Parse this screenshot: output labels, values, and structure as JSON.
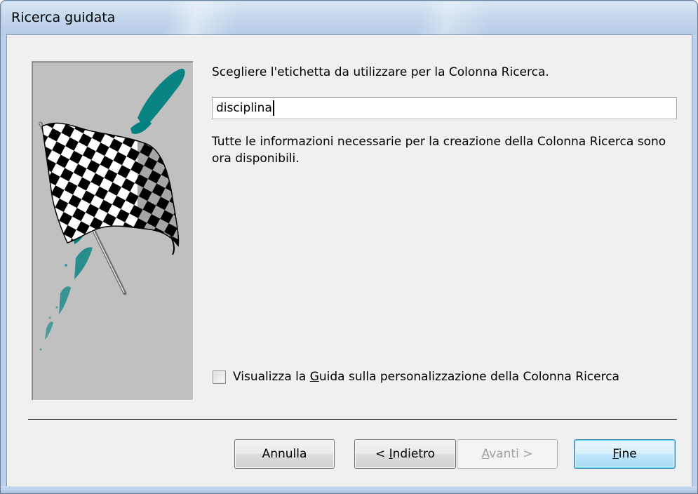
{
  "window": {
    "title": "Ricerca guidata"
  },
  "wizard": {
    "image": "checkered-flag-illustration",
    "prompt": "Scegliere l'etichetta da utilizzare per la Colonna Ricerca.",
    "label_value": "disciplina",
    "info": "Tutte le informazioni necessarie per la creazione della Colonna Ricerca sono ora disponibili.",
    "help_checkbox": {
      "checked": false,
      "label_before": "Visualizza la ",
      "label_accel": "G",
      "label_after": "uida sulla personalizzazione della Colonna Ricerca"
    }
  },
  "buttons": {
    "cancel": "Annulla",
    "back_prefix": "< ",
    "back_accel": "I",
    "back_rest": "ndietro",
    "next_accel": "A",
    "next_rest": "vanti >",
    "finish_accel": "F",
    "finish_rest": "ine"
  },
  "colors": {
    "teal_brush": "#008080",
    "panel_gray": "#c0c0c0",
    "dialog_bg": "#f0f0f0"
  }
}
